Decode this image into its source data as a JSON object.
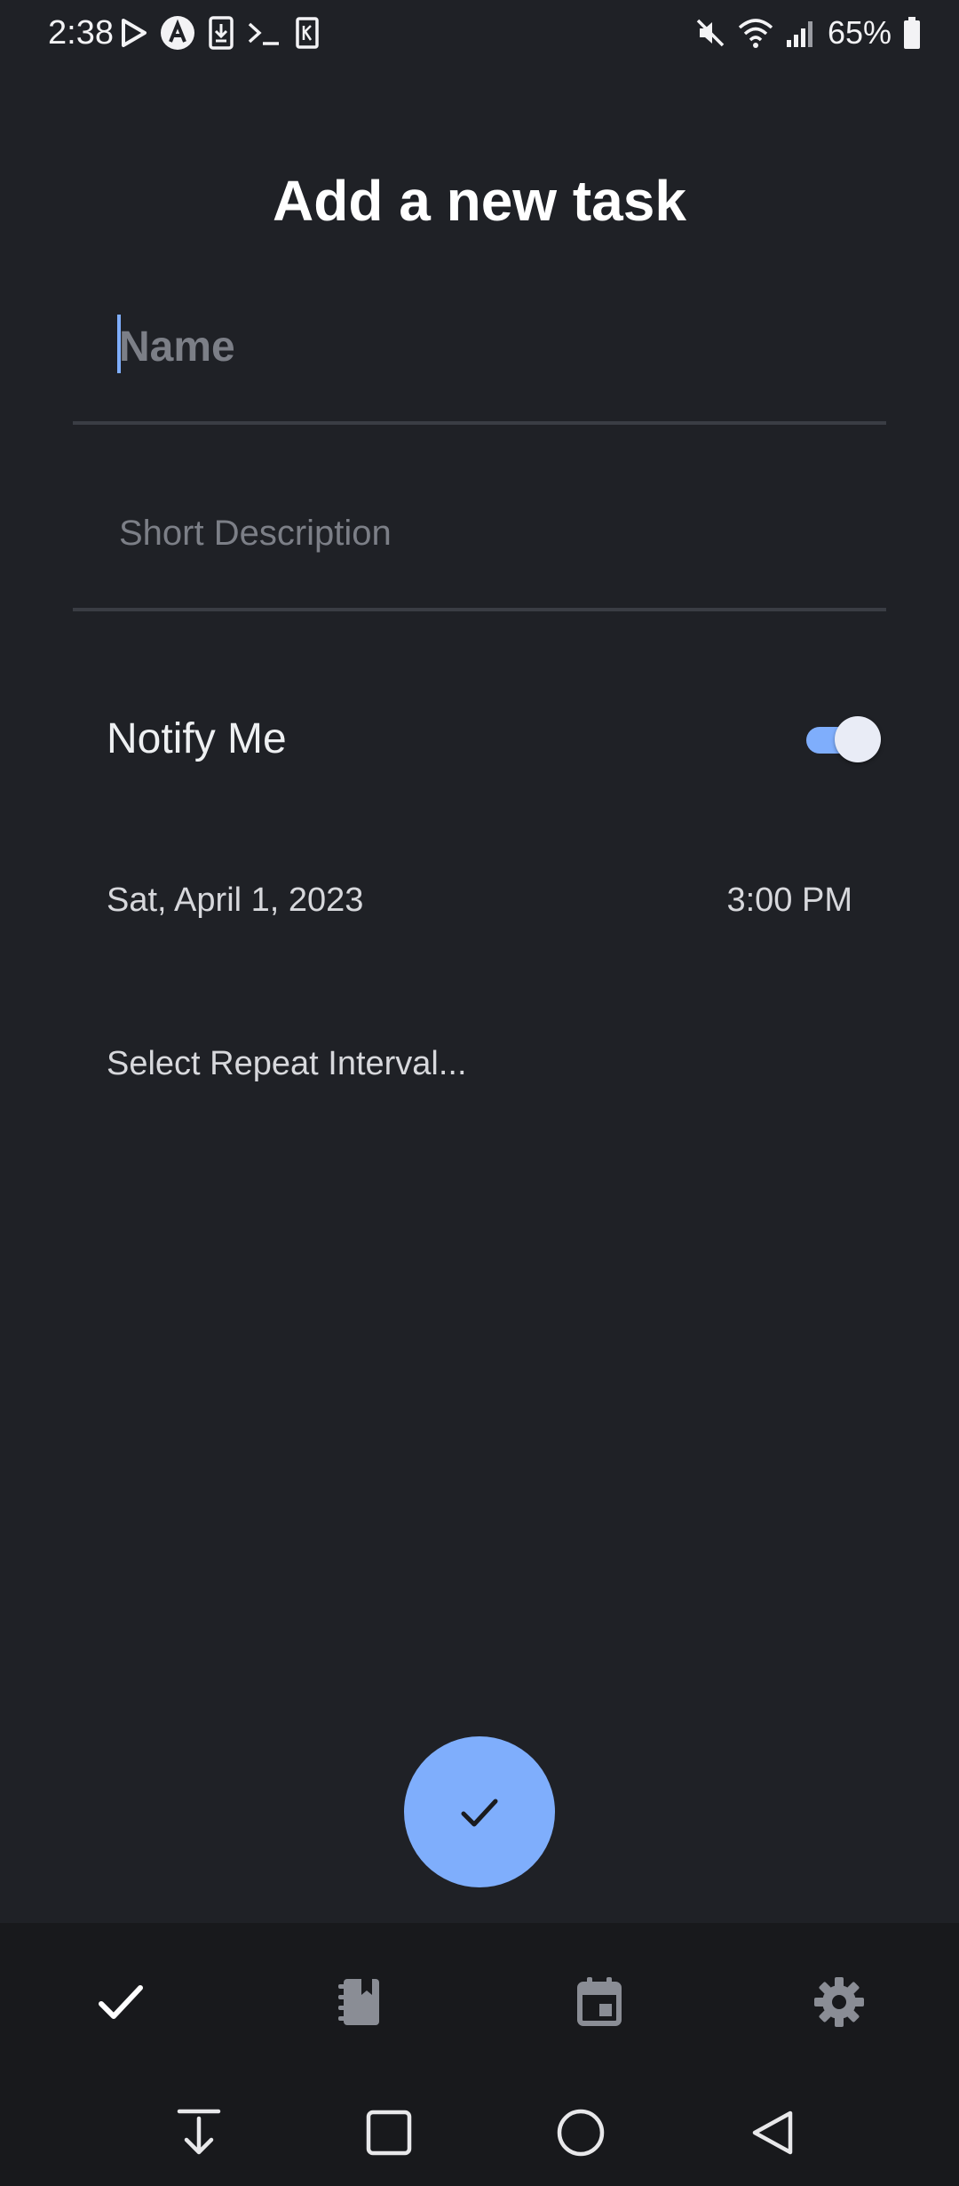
{
  "status_bar": {
    "time": "2:38",
    "battery_percent": "65%",
    "left_icons": [
      "play-store-icon",
      "app-a-icon",
      "download-icon",
      "terminal-icon",
      "k-icon"
    ],
    "right_icons": [
      "mute-icon",
      "wifi-icon",
      "signal-icon",
      "battery-icon"
    ]
  },
  "page": {
    "title": "Add a new task"
  },
  "form": {
    "name_placeholder": "Name",
    "name_value": "",
    "description_placeholder": "Short Description",
    "description_value": "",
    "notify_label": "Notify Me",
    "notify_enabled": true,
    "date": "Sat, April 1, 2023",
    "time": "3:00 PM",
    "repeat_placeholder": "Select Repeat Interval..."
  },
  "fab": {
    "icon": "check-icon"
  },
  "bottom_nav": {
    "items": [
      {
        "icon": "check-icon",
        "active": true
      },
      {
        "icon": "notebook-icon",
        "active": false
      },
      {
        "icon": "calendar-icon",
        "active": false
      },
      {
        "icon": "gear-icon",
        "active": false
      }
    ]
  },
  "system_nav": {
    "items": [
      "download-arrow-icon",
      "recents-square-icon",
      "home-circle-icon",
      "back-triangle-icon"
    ]
  },
  "colors": {
    "background": "#1f2126",
    "accent": "#7faefc",
    "nav_background": "#18191c",
    "divider": "#3a3d44"
  }
}
